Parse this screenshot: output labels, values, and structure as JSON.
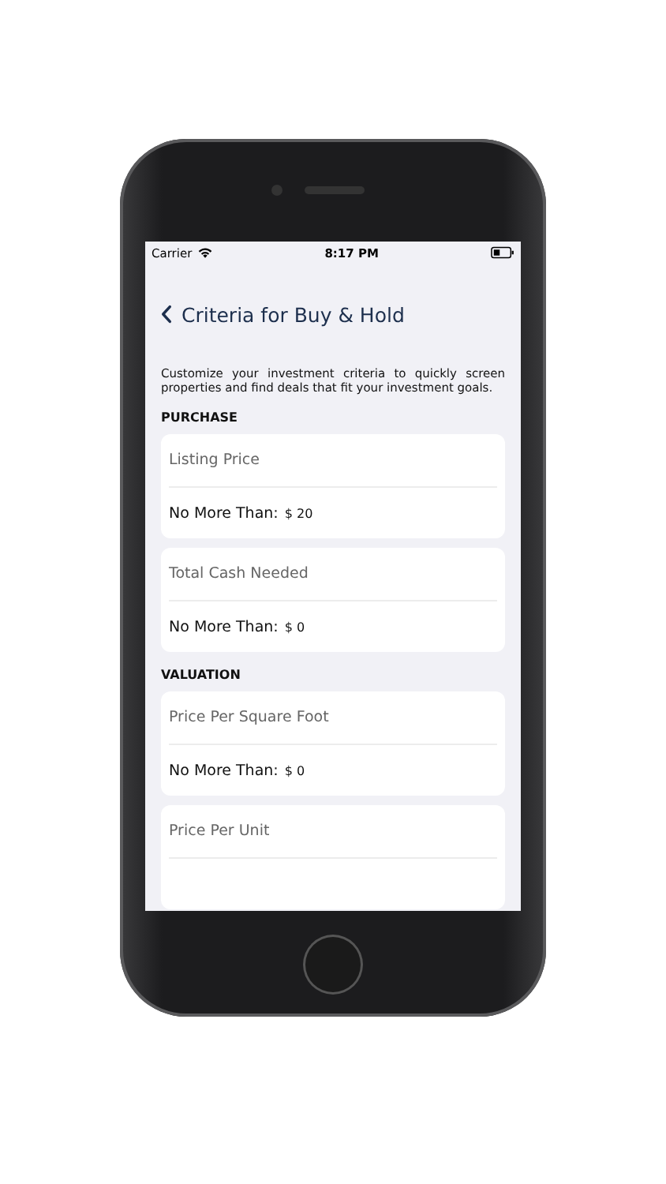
{
  "status_bar": {
    "carrier": "Carrier",
    "time": "8:17 PM"
  },
  "nav": {
    "title": "Criteria for Buy & Hold"
  },
  "description": "Customize your investment criteria to quickly screen properties and find deals that fit your investment goals.",
  "sections": [
    {
      "title": "PURCHASE",
      "items": [
        {
          "label": "Listing Price",
          "condition": "No More Than:",
          "value": "$ 20"
        },
        {
          "label": "Total Cash Needed",
          "condition": "No More Than:",
          "value": "$ 0"
        }
      ]
    },
    {
      "title": "VALUATION",
      "items": [
        {
          "label": "Price Per Square Foot",
          "condition": "No More Than:",
          "value": "$ 0"
        },
        {
          "label": "Price Per Unit"
        }
      ]
    }
  ]
}
